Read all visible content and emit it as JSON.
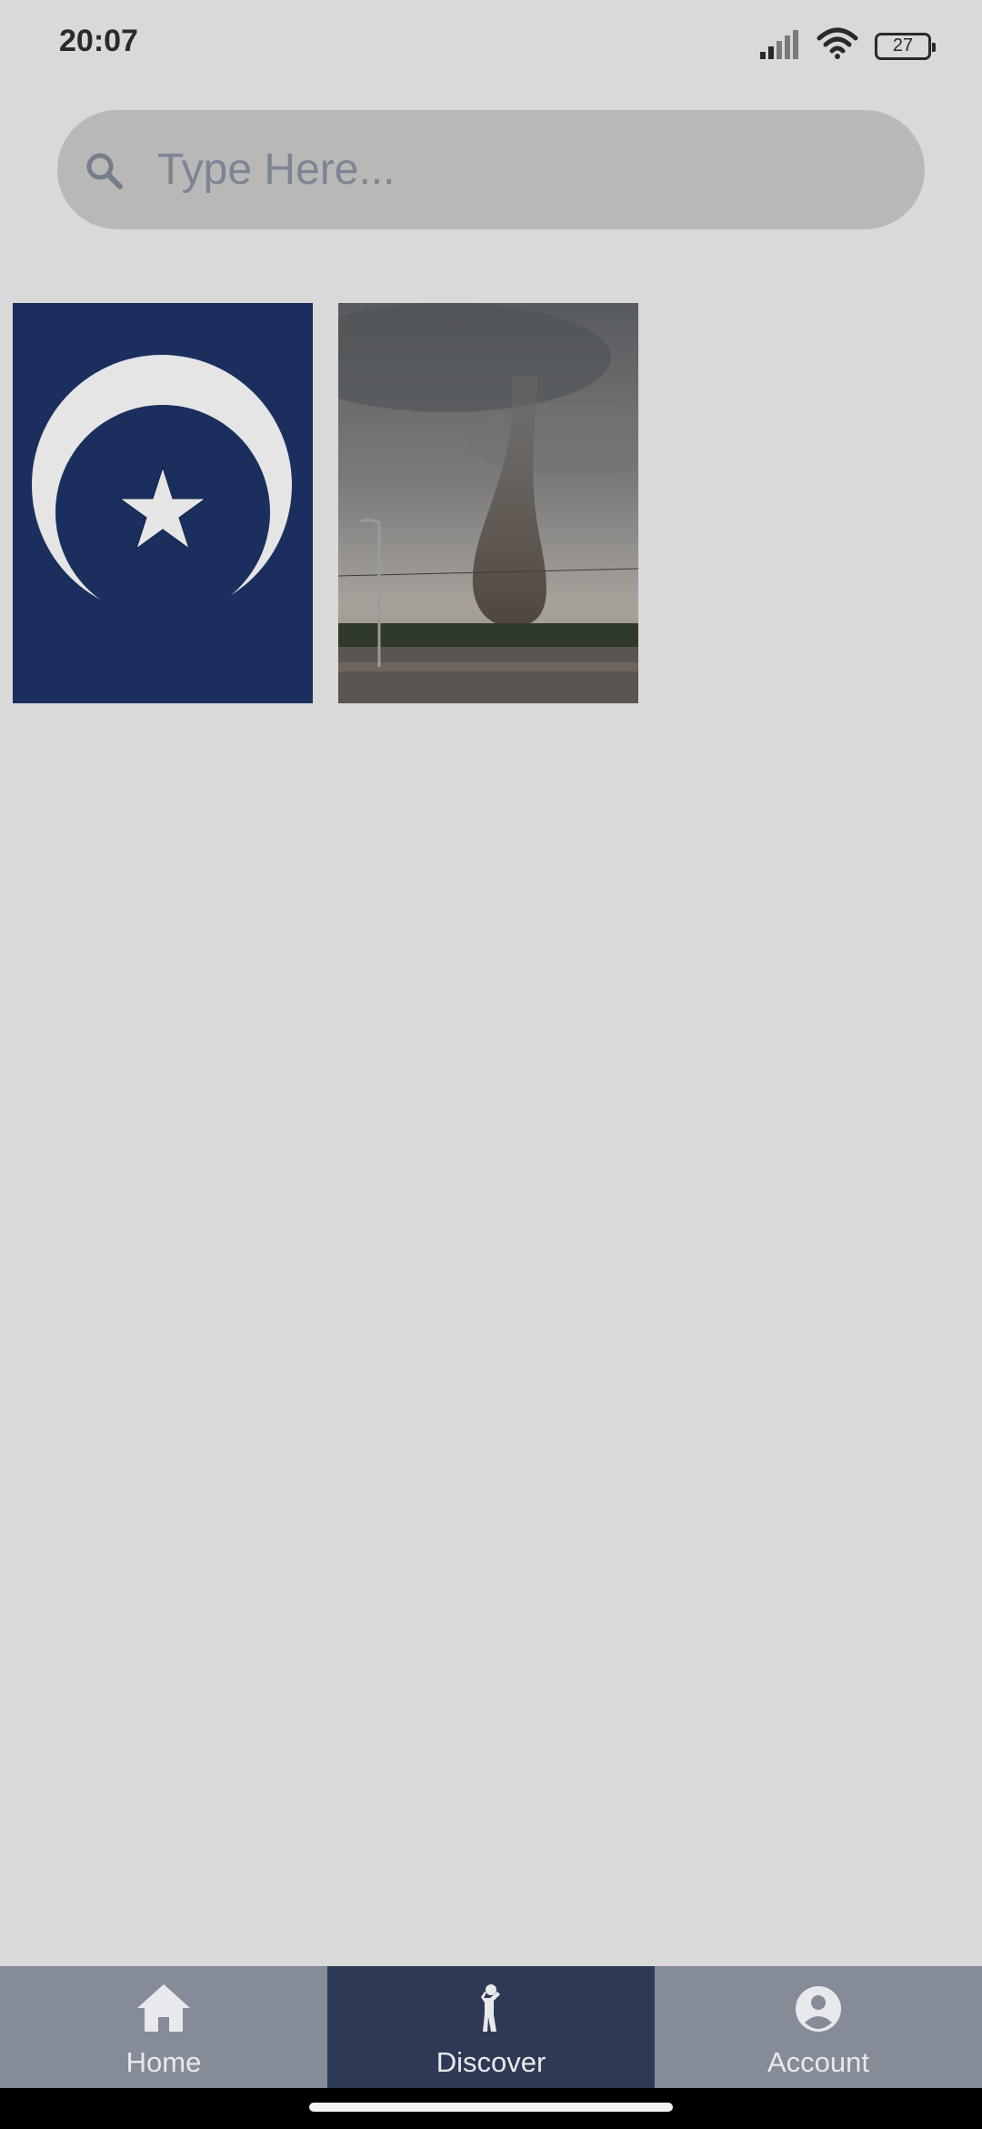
{
  "status_bar": {
    "time": "20:07",
    "battery": "27",
    "icons": [
      "signal-icon",
      "wifi-icon",
      "battery-icon"
    ]
  },
  "search": {
    "placeholder": "Type Here...",
    "value": "",
    "icon": "search-icon"
  },
  "grid": {
    "items": [
      {
        "name": "crescent-star-logo",
        "kind": "image"
      },
      {
        "name": "tornado-photo",
        "kind": "image"
      }
    ]
  },
  "bottom_nav": {
    "items": [
      {
        "label": "Home",
        "icon": "home-icon",
        "active": false
      },
      {
        "label": "Discover",
        "icon": "discover-icon",
        "active": true
      },
      {
        "label": "Account",
        "icon": "account-icon",
        "active": false
      }
    ]
  },
  "colors": {
    "background": "#d9d9d9",
    "search_bg": "#b8b8b6",
    "nav_bg": "#858b97",
    "nav_active": "#2e3a55",
    "logo_blue": "#1b2f5e"
  }
}
